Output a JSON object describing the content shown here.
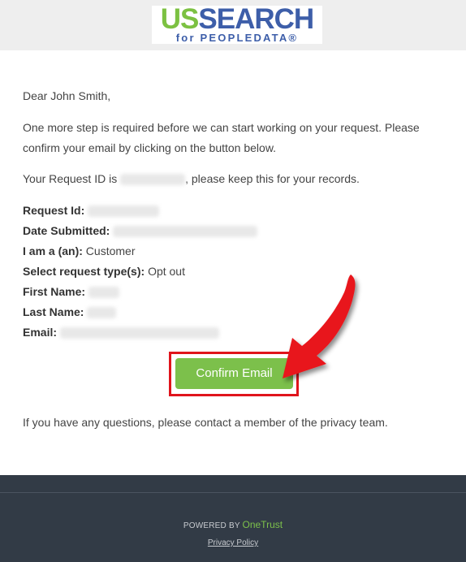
{
  "header": {
    "logo_primary_us": "US",
    "logo_primary_search": "SEARCH",
    "logo_secondary": "for PEOPLEDATA®"
  },
  "email": {
    "greeting": "Dear John Smith,",
    "step_text": "One more step is required before we can start working on your request. Please confirm your email by clicking on the button below.",
    "request_id_prefix": "Your Request ID is",
    "request_id_suffix": ", please keep this for your records.",
    "fields": {
      "request_id_label": "Request Id:",
      "date_submitted_label": "Date Submitted:",
      "iam_label": "I am a (an):",
      "iam_value": "Customer",
      "request_type_label": "Select request type(s):",
      "request_type_value": "Opt out",
      "first_name_label": "First Name:",
      "last_name_label": "Last Name:",
      "email_label": "Email:"
    },
    "confirm_button": "Confirm Email",
    "questions_text": "If you have any questions, please contact a member of the privacy team."
  },
  "footer": {
    "powered_by": "POWERED BY",
    "powered_brand": "OneTrust",
    "privacy_link": "Privacy Policy"
  },
  "colors": {
    "accent_green": "#7cc04b",
    "logo_blue": "#3d5ea9",
    "highlight_red": "#e0141c",
    "footer_bg": "#323b46"
  }
}
